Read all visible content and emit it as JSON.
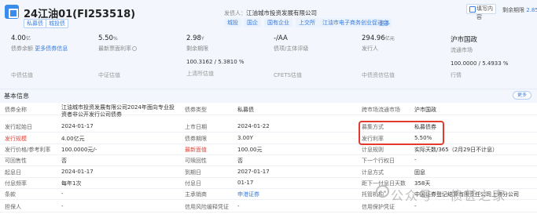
{
  "header": {
    "title": "24江油01(FI253518)",
    "tags": [
      "私募债",
      "城投债"
    ],
    "issuer_label": "发债人：",
    "issuer_name": "江油城市投资发展有限公司",
    "issuer_tags": [
      "城投",
      "国企",
      "国有企业",
      "上交所",
      "江油市电子商务创业促进会"
    ],
    "issuer_more": "更多",
    "watch_label": "填写内容",
    "duration_label": "剩余期限",
    "duration_value": "2.85"
  },
  "metrics": [
    {
      "value": "4.00",
      "unit": "亿",
      "label": "债券余额",
      "label2": "更多债券信息",
      "sub": "中债估值"
    },
    {
      "value": "5.50",
      "unit": "%",
      "label": "最新票面利率",
      "label2": "",
      "sub": "中证估值"
    },
    {
      "value": "2.98",
      "unit": "Y",
      "label": "剩余期限",
      "label2": "",
      "sub2": "100.3162 / 5.3810 %",
      "sub": "上清所估值"
    },
    {
      "value": "-/AA",
      "unit": "",
      "label": "债项/主体评级",
      "label2": "",
      "sub": "CFETS估值"
    },
    {
      "value": "294.96",
      "unit": "亿元",
      "label": "发行人",
      "label2": "",
      "sub": "中债资信估值"
    },
    {
      "value": "沪市国政",
      "unit": "",
      "label": "流通市场",
      "label2": "",
      "sub2": "100.0000 / 5.4933 %",
      "sub": "行情"
    }
  ],
  "basic_info": {
    "section_title": "基本信息",
    "more_label": "更多",
    "rows": [
      [
        [
          "债券全称",
          "江油城市投资发展有限公司2024年面向专业投资者非公开发行公司债券",
          false
        ],
        [
          "债券类型",
          "私募债",
          false
        ],
        [
          "跨市场流通市场",
          "沪市国政",
          false
        ]
      ],
      [
        [
          "发行起始日",
          "2024-01-17",
          false
        ],
        [
          "上市日期",
          "2024-01-22",
          false
        ],
        [
          "募集方式",
          "私募债券",
          false
        ]
      ],
      [
        [
          "发行规模",
          "4.00亿元",
          true
        ],
        [
          "债券期限",
          "3.00Y",
          false
        ],
        [
          "发行利率",
          "5.50%",
          false
        ]
      ],
      [
        [
          "发行价格/参考利率",
          "100.0000元/-",
          false
        ],
        [
          "最新面值",
          "100.00元",
          true
        ],
        [
          "计息规则",
          "实际天数/365（2月29日不计息）",
          false
        ]
      ],
      [
        [
          "可回售性",
          "否",
          false
        ],
        [
          "可赎回性",
          "否",
          false
        ],
        [
          "下一个行权日",
          "-",
          false
        ]
      ],
      [
        [
          "起息日",
          "2024-01-17",
          false
        ],
        [
          "到期日",
          "2027-01-17",
          false
        ],
        [
          "计息方式",
          "固息",
          false
        ]
      ],
      [
        [
          "付息频率",
          "每年1次",
          false
        ],
        [
          "付息日",
          "01-17",
          false
        ],
        [
          "距下一付息日天数",
          "358天",
          false
        ]
      ],
      [
        [
          "条款",
          "-",
          false
        ],
        [
          "主承销商",
          "申港证券",
          false
        ],
        [
          "托管机构",
          "中国证券登记结算有限责任公司上海分公司",
          false
        ]
      ],
      [
        [
          "担保人",
          "-",
          false
        ],
        [
          "信用风险缓释凭证",
          "-",
          false
        ],
        [
          "信用保护凭证",
          "-",
          false
        ]
      ]
    ]
  },
  "watermark": "公众号 · 债甚之家"
}
